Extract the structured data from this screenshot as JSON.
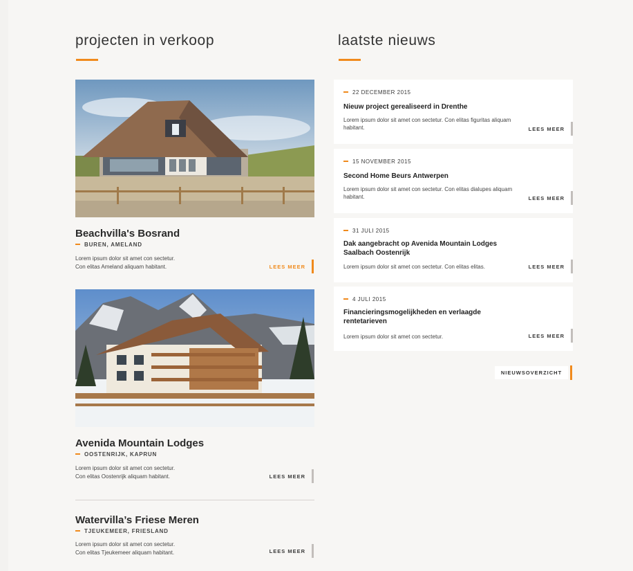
{
  "projects_section": {
    "title": "projecten in verkoop",
    "items": [
      {
        "name": "Beachvilla's Bosrand",
        "location": "BUREN, AMELAND",
        "desc_line1": "Lorem ipsum dolor sit amet con sectetur.",
        "desc_line2": "Con elitas Ameland aliquam habitant.",
        "more_label": "LEES MEER",
        "highlighted": true
      },
      {
        "name": "Avenida Mountain Lodges",
        "location": "OOSTENRIJK, KAPRUN",
        "desc_line1": "Lorem ipsum dolor sit amet con sectetur.",
        "desc_line2": "Con elitas Oostenrijk aliquam habitant.",
        "more_label": "LEES MEER",
        "highlighted": false
      },
      {
        "name": "Watervilla’s Friese Meren",
        "location": "TJEUKEMEER, FRIESLAND",
        "desc_line1": "Lorem ipsum dolor sit amet con sectetur.",
        "desc_line2": "Con elitas Tjeukemeer aliquam habitant.",
        "more_label": "LEES MEER",
        "highlighted": false
      }
    ]
  },
  "news_section": {
    "title": "laatste nieuws",
    "items": [
      {
        "date": "22 DECEMBER 2015",
        "title": "Nieuw project gerealiseerd in Drenthe",
        "text": "Lorem ipsum dolor sit amet con sectetur. Con elitas figuritas aliquam habitant.",
        "more_label": "LEES MEER"
      },
      {
        "date": "15 NOVEMBER 2015",
        "title": "Second Home Beurs Antwerpen",
        "text": "Lorem ipsum dolor sit amet con sectetur. Con elitas dialupes aliquam habitant.",
        "more_label": "LEES MEER"
      },
      {
        "date": "31 JULI 2015",
        "title": "Dak aangebracht op Avenida Mountain Lodges Saalbach Oostenrijk",
        "text": "Lorem ipsum dolor sit amet con sectetur. Con elitas elitas.",
        "more_label": "LEES MEER"
      },
      {
        "date": "4 JULI 2015",
        "title": "Financieringsmogelijkheden en verlaagde rentetarieven",
        "text": "Lorem ipsum dolor sit amet con sectetur.",
        "more_label": "LEES MEER"
      }
    ],
    "overview_label": "NIEUWSOVERZICHT"
  },
  "colors": {
    "accent": "#f08a1c",
    "background": "#f7f6f4",
    "card": "#ffffff",
    "neutral_bar": "#c2bebb"
  },
  "icons": {
    "date_marker": "orange-dash-icon"
  }
}
